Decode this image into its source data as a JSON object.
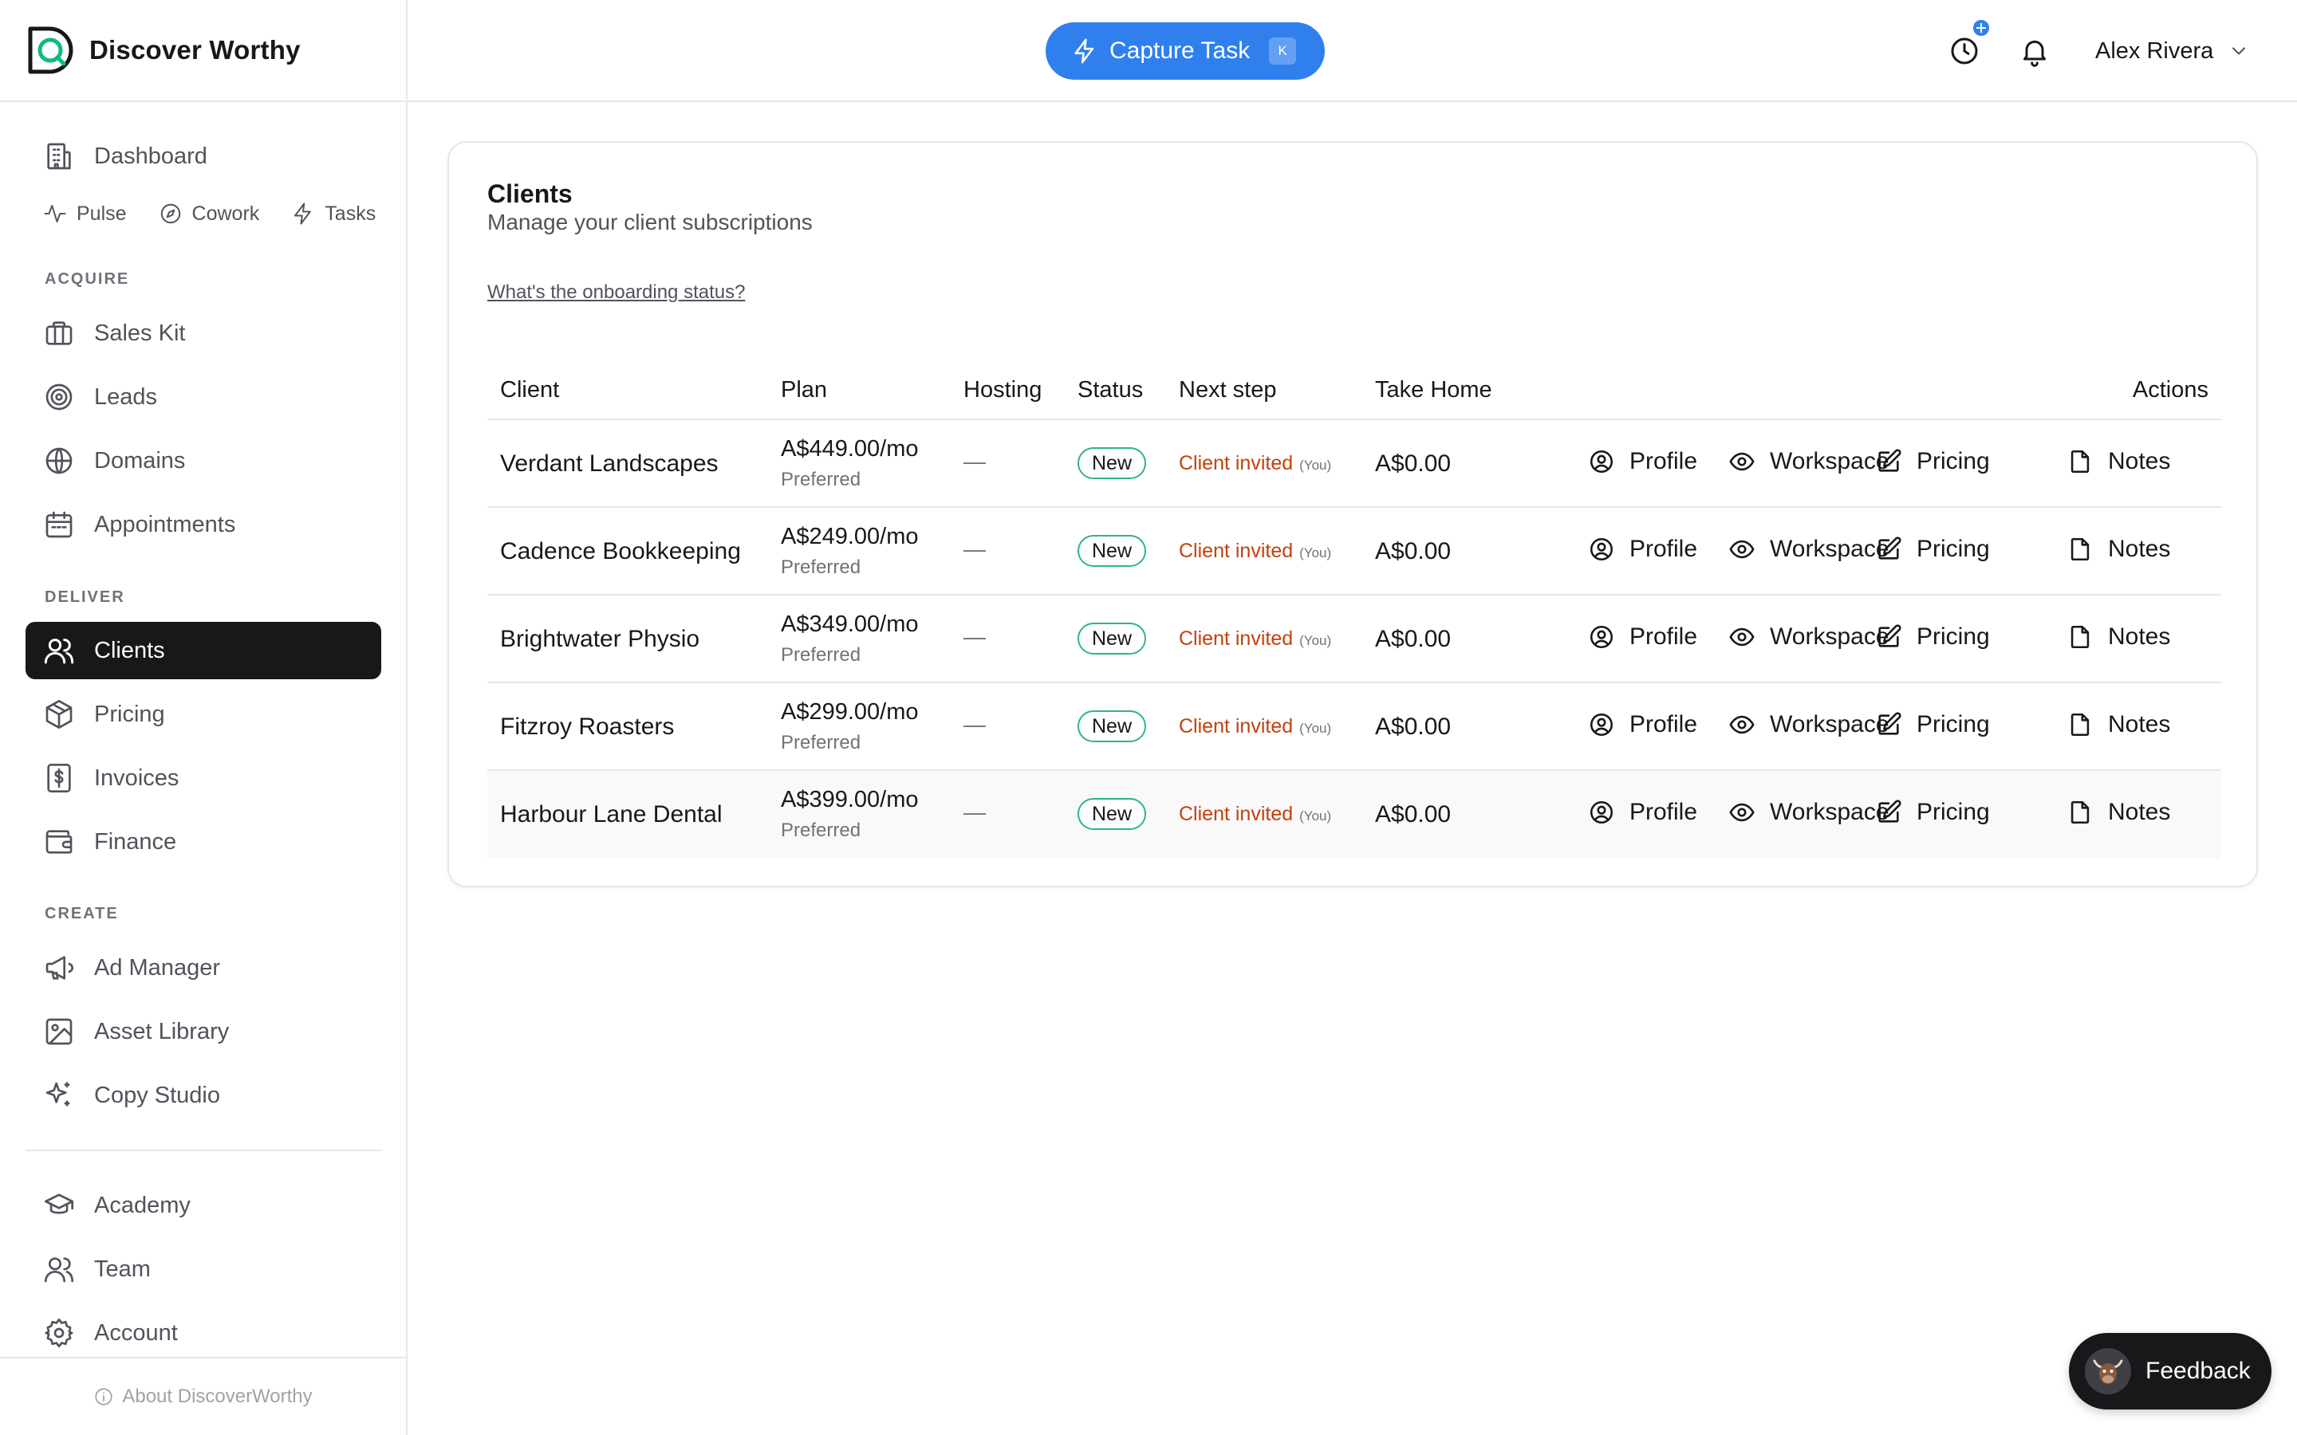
{
  "brand": {
    "name": "Discover Worthy"
  },
  "sidebar": {
    "dashboard": "Dashboard",
    "subnav": [
      "Pulse",
      "Cowork",
      "Tasks"
    ],
    "sections": {
      "acquire": "ACQUIRE",
      "deliver": "DELIVER",
      "create": "CREATE"
    },
    "acquire_items": [
      "Sales Kit",
      "Leads",
      "Domains",
      "Appointments"
    ],
    "deliver_items": [
      "Clients",
      "Pricing",
      "Invoices",
      "Finance"
    ],
    "create_items": [
      "Ad Manager",
      "Asset Library",
      "Copy Studio"
    ],
    "bottom_items": [
      "Academy",
      "Team",
      "Account"
    ],
    "active_item": "Clients",
    "footer": "About DiscoverWorthy"
  },
  "topbar": {
    "capture_label": "Capture Task",
    "capture_shortcut": "K",
    "user_name": "Alex Rivera",
    "accent_color": "#2f80ed"
  },
  "clients_card": {
    "title": "Clients",
    "subtitle": "Manage your client subscriptions",
    "onboarding_link": "What's the onboarding status?",
    "columns": {
      "client": "Client",
      "plan": "Plan",
      "hosting": "Hosting",
      "status": "Status",
      "next_step": "Next step",
      "take_home": "Take Home",
      "actions": "Actions"
    },
    "action_labels": {
      "profile": "Profile",
      "workspace": "Workspace",
      "pricing": "Pricing",
      "notes": "Notes"
    },
    "rows": [
      {
        "client": "Verdant Landscapes",
        "plan_price": "A$449.00/mo",
        "plan_tier": "Preferred",
        "hosting": "—",
        "status": "New",
        "next_step": "Client invited",
        "next_step_owner": "(You)",
        "take_home": "A$0.00"
      },
      {
        "client": "Cadence Bookkeeping",
        "plan_price": "A$249.00/mo",
        "plan_tier": "Preferred",
        "hosting": "—",
        "status": "New",
        "next_step": "Client invited",
        "next_step_owner": "(You)",
        "take_home": "A$0.00"
      },
      {
        "client": "Brightwater Physio",
        "plan_price": "A$349.00/mo",
        "plan_tier": "Preferred",
        "hosting": "—",
        "status": "New",
        "next_step": "Client invited",
        "next_step_owner": "(You)",
        "take_home": "A$0.00"
      },
      {
        "client": "Fitzroy Roasters",
        "plan_price": "A$299.00/mo",
        "plan_tier": "Preferred",
        "hosting": "—",
        "status": "New",
        "next_step": "Client invited",
        "next_step_owner": "(You)",
        "take_home": "A$0.00"
      },
      {
        "client": "Harbour Lane Dental",
        "plan_price": "A$399.00/mo",
        "plan_tier": "Preferred",
        "hosting": "—",
        "status": "New",
        "next_step": "Client invited",
        "next_step_owner": "(You)",
        "take_home": "A$0.00"
      }
    ]
  },
  "feedback": {
    "label": "Feedback"
  }
}
